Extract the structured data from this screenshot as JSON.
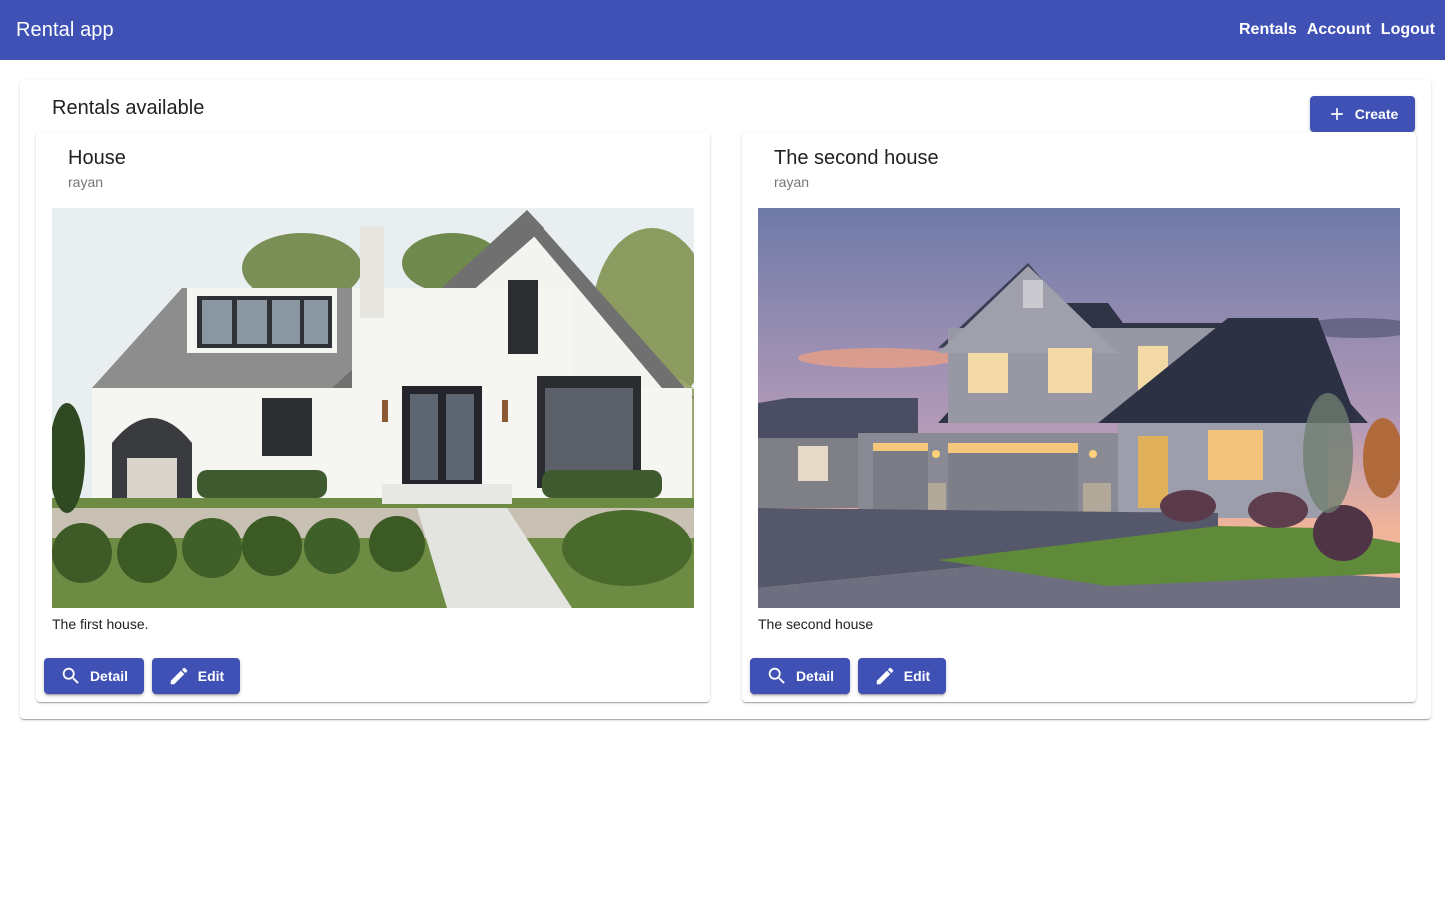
{
  "app": {
    "title": "Rental app"
  },
  "nav": [
    {
      "label": "Rentals"
    },
    {
      "label": "Account"
    },
    {
      "label": "Logout"
    }
  ],
  "page": {
    "title": "Rentals available",
    "create_label": "Create",
    "create_icon": "add-icon"
  },
  "rentals": [
    {
      "title": "House",
      "owner": "rayan",
      "description": "The first house.",
      "image": "white-cottage-house-photo",
      "detail_label": "Detail",
      "edit_label": "Edit"
    },
    {
      "title": "The second house",
      "owner": "rayan",
      "description": "The second house",
      "image": "gray-two-story-house-at-dusk-photo",
      "detail_label": "Detail",
      "edit_label": "Edit"
    }
  ],
  "colors": {
    "primary": "#3f51b5",
    "text": "#212121",
    "subtitle": "#757575"
  }
}
